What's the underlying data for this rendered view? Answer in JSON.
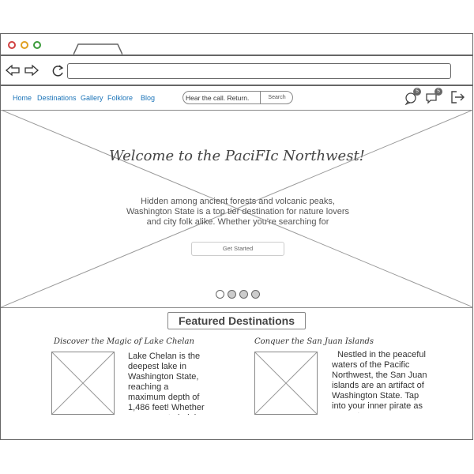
{
  "nav": {
    "links": [
      "Home",
      "Destinations",
      "Gallery",
      "Folklore",
      "Blog"
    ]
  },
  "search": {
    "value": "Hear the call. Return.",
    "button_label": "Search"
  },
  "icons": {
    "notifications_count": "5",
    "messages_count": "5"
  },
  "hero": {
    "title": "Welcome to the PaciFIc Northwest!",
    "text": "Hidden among ancient forests and volcanic peaks, Washington State is a top tier destination for nature lovers and city folk alike. Whether you're searching for",
    "button_label": "Get Started"
  },
  "featured": {
    "title": "Featured Destinations",
    "cards": [
      {
        "title": "Discover the Magic of Lake Chelan",
        "text": "Lake Chelan is the deepest lake in Washington State, reaching a maximum depth of 1,486 feet! Whether you come to indulge"
      },
      {
        "title": "Conquer the San Juan Islands",
        "text": "Nestled in the peaceful waters of the Pacific Northwest, the San Juan islands are an artifact of Washington State. Tap into your inner pirate as you set"
      }
    ]
  }
}
